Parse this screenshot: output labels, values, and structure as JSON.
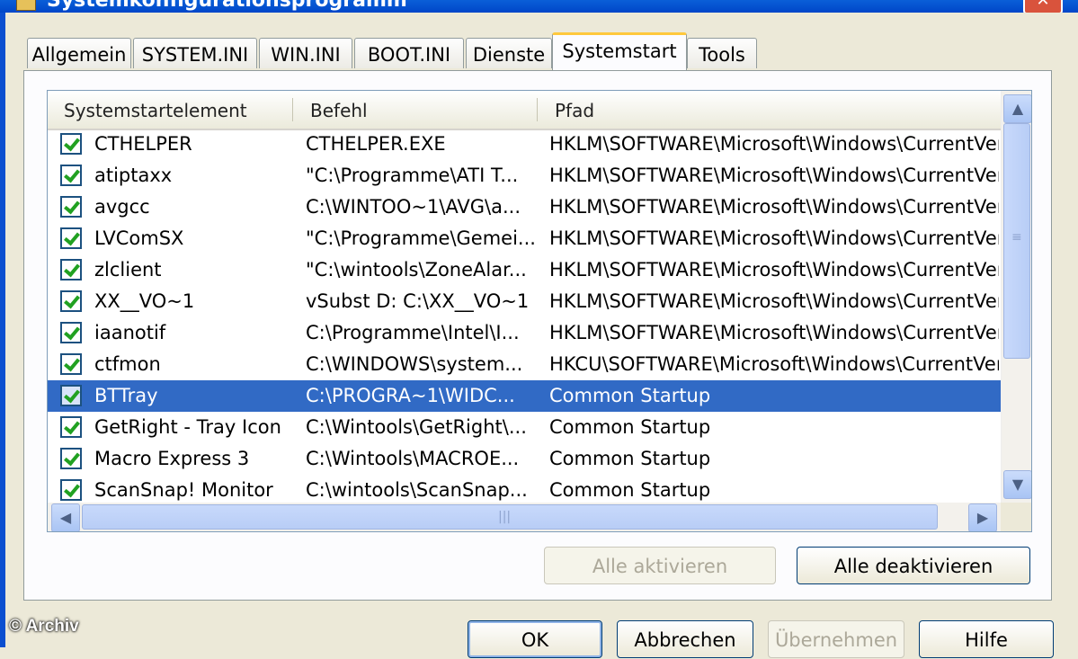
{
  "window": {
    "title": "Systemkonfigurationsprogramm",
    "close_symbol": "✕"
  },
  "tabs": [
    {
      "label": "Allgemein"
    },
    {
      "label": "SYSTEM.INI"
    },
    {
      "label": "WIN.INI"
    },
    {
      "label": "BOOT.INI"
    },
    {
      "label": "Dienste"
    },
    {
      "label": "Systemstart",
      "active": true
    },
    {
      "label": "Tools"
    }
  ],
  "list": {
    "columns": [
      "Systemstartelement",
      "Befehl",
      "Pfad"
    ],
    "rows": [
      {
        "checked": true,
        "item": "CTHELPER",
        "command": "CTHELPER.EXE",
        "path": "HKLM\\SOFTWARE\\Microsoft\\Windows\\CurrentVer..."
      },
      {
        "checked": true,
        "item": "atiptaxx",
        "command": "\"C:\\Programme\\ATI T...",
        "path": "HKLM\\SOFTWARE\\Microsoft\\Windows\\CurrentVer..."
      },
      {
        "checked": true,
        "item": "avgcc",
        "command": "C:\\WINTOO~1\\AVG\\a...",
        "path": "HKLM\\SOFTWARE\\Microsoft\\Windows\\CurrentVer..."
      },
      {
        "checked": true,
        "item": "LVComSX",
        "command": "\"C:\\Programme\\Gemei...",
        "path": "HKLM\\SOFTWARE\\Microsoft\\Windows\\CurrentVer..."
      },
      {
        "checked": true,
        "item": "zlclient",
        "command": "\"C:\\wintools\\ZoneAlar...",
        "path": "HKLM\\SOFTWARE\\Microsoft\\Windows\\CurrentVer..."
      },
      {
        "checked": true,
        "item": "XX__VO~1",
        "command": "vSubst D:  C:\\XX__VO~1",
        "path": "HKLM\\SOFTWARE\\Microsoft\\Windows\\CurrentVer..."
      },
      {
        "checked": true,
        "item": "iaanotif",
        "command": "C:\\Programme\\Intel\\I...",
        "path": "HKLM\\SOFTWARE\\Microsoft\\Windows\\CurrentVer..."
      },
      {
        "checked": true,
        "item": "ctfmon",
        "command": "C:\\WINDOWS\\system...",
        "path": "HKCU\\SOFTWARE\\Microsoft\\Windows\\CurrentVer..."
      },
      {
        "checked": true,
        "item": "BTTray",
        "command": "C:\\PROGRA~1\\WIDC...",
        "path": "Common Startup",
        "selected": true
      },
      {
        "checked": true,
        "item": "GetRight - Tray Icon",
        "command": "C:\\Wintools\\GetRight\\...",
        "path": "Common Startup"
      },
      {
        "checked": true,
        "item": "Macro Express 3",
        "command": "C:\\Wintools\\MACROE...",
        "path": "Common Startup"
      },
      {
        "checked": true,
        "item": "ScanSnap! Monitor",
        "command": "C:\\wintools\\ScanSnap...",
        "path": "Common Startup"
      }
    ]
  },
  "scroll": {
    "up": "▲",
    "down": "▼",
    "left": "◀",
    "right": "▶",
    "vgrip": "≡",
    "hgrip": "|||"
  },
  "buttons": {
    "enable_all": "Alle aktivieren",
    "disable_all": "Alle deaktivieren",
    "ok": "OK",
    "cancel": "Abbrechen",
    "apply": "Übernehmen",
    "help": "Hilfe"
  },
  "watermark": "© Archiv",
  "colors": {
    "selection": "#316ac5",
    "active_tab_accent": "#ffc83c",
    "titlebar": "#0a5fd8"
  }
}
